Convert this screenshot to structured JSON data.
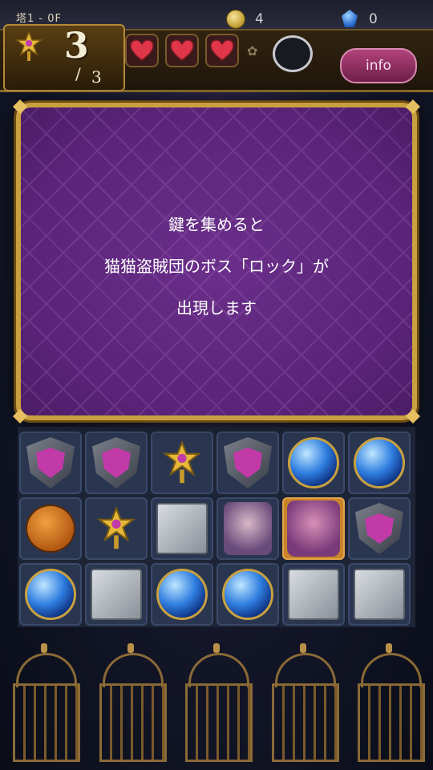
{
  "hud": {
    "floor_label": "塔1 - 0F",
    "coins": "4",
    "gems": "0",
    "keys_collected": "3",
    "keys_slash": "/",
    "keys_total": "3",
    "hearts": 3,
    "info_button": "info"
  },
  "dialog": {
    "line1": "鍵を集めると",
    "line2": "猫猫盗賊団のボス「ロック」が",
    "line3": "出現します"
  },
  "board": {
    "rows": [
      [
        "shield",
        "shield",
        "key",
        "shield",
        "orb",
        "orb"
      ],
      [
        "bomb",
        "key",
        "block",
        "character",
        "boss-rock",
        "shield"
      ],
      [
        "orb",
        "block",
        "orb",
        "orb",
        "block",
        "block"
      ]
    ]
  },
  "cages": 5,
  "colors": {
    "dialog_bg": "#5a2478",
    "dialog_border": "#c9a040",
    "info_button": "#b1427a"
  }
}
